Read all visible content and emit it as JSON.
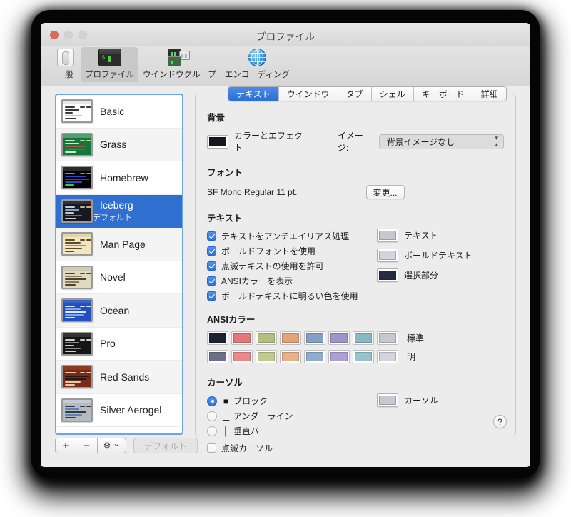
{
  "window": {
    "title": "プロファイル",
    "traffic_lights": [
      "close",
      "minimize",
      "zoom"
    ]
  },
  "toolbar": {
    "items": [
      {
        "label": "一般",
        "icon": "general-icon",
        "selected": false
      },
      {
        "label": "プロファイル",
        "icon": "terminal-icon",
        "selected": true
      },
      {
        "label": "ウインドウグループ",
        "icon": "window-group-icon",
        "selected": false
      },
      {
        "label": "エンコーディング",
        "icon": "globe-icon",
        "selected": false
      }
    ]
  },
  "profile_list": {
    "items": [
      {
        "name": "Basic",
        "subtitle": "",
        "selected": false,
        "bg": "#ffffff",
        "fg": "#3a3a3a",
        "accent": "#9fc8ef"
      },
      {
        "name": "Grass",
        "subtitle": "",
        "selected": false,
        "bg": "#13773d",
        "fg": "#d7e8c4",
        "accent": "#b5533a"
      },
      {
        "name": "Homebrew",
        "subtitle": "",
        "selected": false,
        "bg": "#000000",
        "fg": "#37d037",
        "accent": "#1f49d8"
      },
      {
        "name": "Iceberg",
        "subtitle": "デフォルト",
        "selected": true,
        "bg": "#161821",
        "fg": "#c6c8d1",
        "accent": "#6b7089"
      },
      {
        "name": "Man Page",
        "subtitle": "",
        "selected": false,
        "bg": "#f3e7bf",
        "fg": "#5a4c2a",
        "accent": "#a98f4e"
      },
      {
        "name": "Novel",
        "subtitle": "",
        "selected": false,
        "bg": "#dfdbc3",
        "fg": "#4c4231",
        "accent": "#8d7a55"
      },
      {
        "name": "Ocean",
        "subtitle": "",
        "selected": false,
        "bg": "#224fbc",
        "fg": "#dfe8ff",
        "accent": "#7fa7ef"
      },
      {
        "name": "Pro",
        "subtitle": "",
        "selected": false,
        "bg": "#151515",
        "fg": "#d0d0d0",
        "accent": "#8a8a8a"
      },
      {
        "name": "Red Sands",
        "subtitle": "",
        "selected": false,
        "bg": "#7a2b17",
        "fg": "#e8c9a8",
        "accent": "#1c1c1c"
      },
      {
        "name": "Silver Aerogel",
        "subtitle": "",
        "selected": false,
        "bg": "#b6bbc2",
        "fg": "#33383f",
        "accent": "#5f7fb5"
      }
    ],
    "buttons": {
      "add": "+",
      "remove": "−",
      "gear": "⚙",
      "gear_chevron": "⌄",
      "default": "デフォルト"
    }
  },
  "settings": {
    "tabs": [
      {
        "label": "テキスト",
        "active": true
      },
      {
        "label": "ウインドウ",
        "active": false
      },
      {
        "label": "タブ",
        "active": false
      },
      {
        "label": "シェル",
        "active": false
      },
      {
        "label": "キーボード",
        "active": false
      },
      {
        "label": "詳細",
        "active": false
      }
    ],
    "background": {
      "section_title": "背景",
      "color_label": "カラーとエフェクト",
      "color_value": "#161821",
      "image_label": "イメージ:",
      "image_value": "背景イメージなし"
    },
    "font": {
      "section_title": "フォント",
      "value": "SF Mono Regular 11 pt.",
      "change_button": "変更..."
    },
    "text": {
      "section_title": "テキスト",
      "checkboxes": [
        {
          "label": "テキストをアンチエイリアス処理",
          "checked": true
        },
        {
          "label": "ボールドフォントを使用",
          "checked": true
        },
        {
          "label": "点滅テキストの使用を許可",
          "checked": true
        },
        {
          "label": "ANSIカラーを表示",
          "checked": true
        },
        {
          "label": "ボールドテキストに明るい色を使用",
          "checked": true
        }
      ],
      "color_wells": [
        {
          "label": "テキスト",
          "color": "#c6c8d1"
        },
        {
          "label": "ボールドテキスト",
          "color": "#d2d4de"
        },
        {
          "label": "選択部分",
          "color": "#272c42"
        }
      ]
    },
    "ansi": {
      "section_title": "ANSIカラー",
      "rows": [
        {
          "tag": "標準",
          "colors": [
            "#1e2132",
            "#e27878",
            "#b4be82",
            "#e2a478",
            "#84a0c6",
            "#a093c7",
            "#89b8c2",
            "#c6c8d1"
          ]
        },
        {
          "tag": "明",
          "colors": [
            "#6b7089",
            "#e98989",
            "#c0ca8e",
            "#e9b189",
            "#91acd1",
            "#ada0d3",
            "#95c4ce",
            "#d2d4de"
          ]
        }
      ]
    },
    "cursor": {
      "section_title": "カーソル",
      "options": [
        {
          "label": "ブロック",
          "glyph": "■",
          "selected": true
        },
        {
          "label": "アンダーライン",
          "glyph": "▁",
          "selected": false
        },
        {
          "label": "垂直バー",
          "glyph": "│",
          "selected": false
        }
      ],
      "blink": {
        "label": "点滅カーソル",
        "checked": false
      },
      "color_well": {
        "label": "カーソル",
        "color": "#c6c8d1"
      }
    },
    "help_button": "?"
  }
}
